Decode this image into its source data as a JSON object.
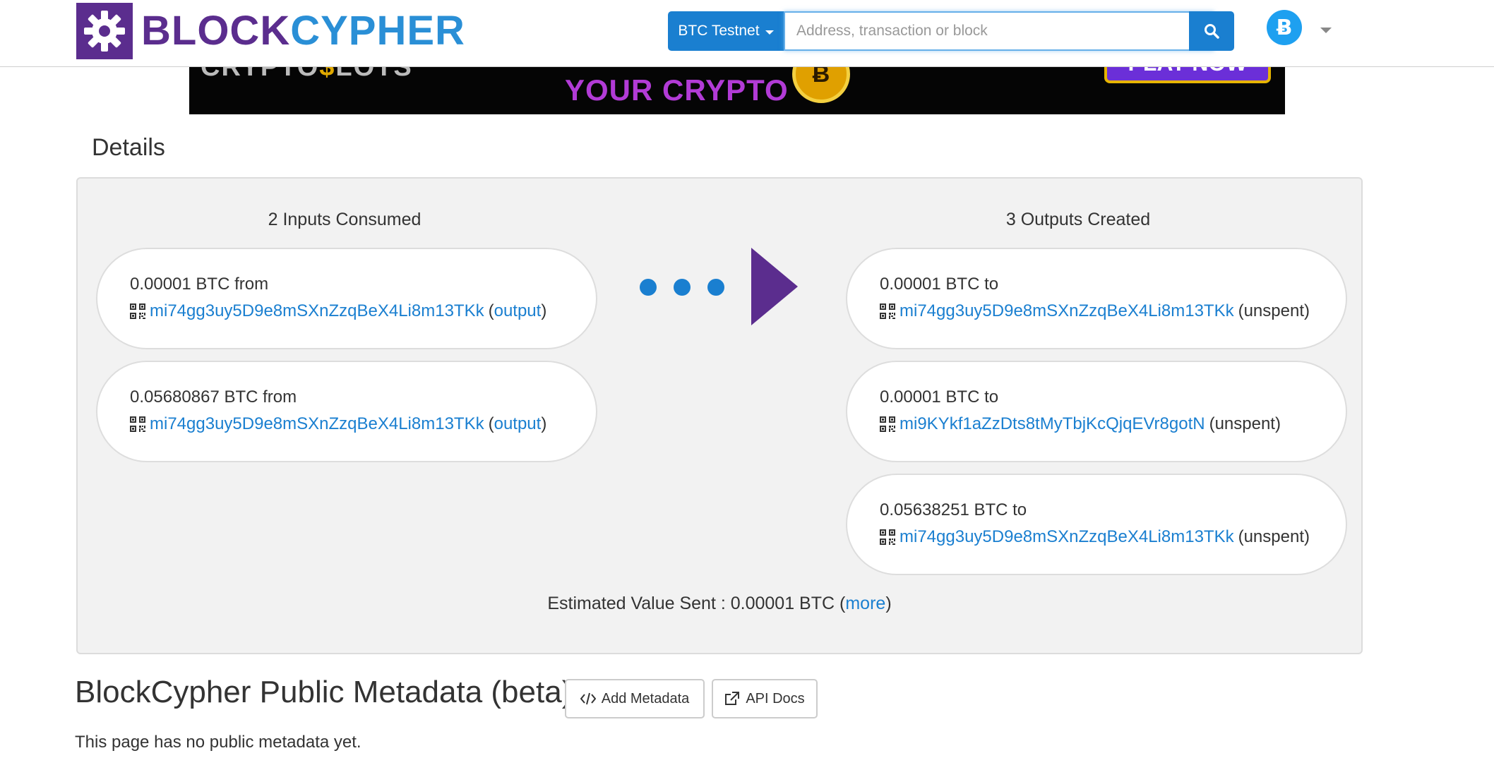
{
  "header": {
    "brand_part1": "BLOCK",
    "brand_part2": "CYPHER",
    "network_label": "BTC Testnet",
    "search_placeholder": "Address, transaction or block",
    "coin_symbol": "Ƀ",
    "colors": {
      "brand_purple": "#5b2d8e",
      "brand_blue": "#2a8fd6",
      "button_blue": "#1a7fd0",
      "coin_blue": "#1ea0f0"
    }
  },
  "banner": {
    "brand_fragment_a": "CRYPTO",
    "brand_fragment_b": "$",
    "brand_fragment_c": "LOTS",
    "headline": "YOUR CRYPTO",
    "coin_symbol": "Ƀ",
    "cta": "PLAY NOW"
  },
  "details": {
    "title": "Details",
    "inputs_heading": "2 Inputs Consumed",
    "outputs_heading": "3 Outputs Created",
    "inputs": [
      {
        "amount": "0.00001 BTC from",
        "address": "mi74gg3uy5D9e8mSXnZzqBeX4Li8m13TKk",
        "link_label": "output"
      },
      {
        "amount": "0.05680867 BTC from",
        "address": "mi74gg3uy5D9e8mSXnZzqBeX4Li8m13TKk",
        "link_label": "output"
      }
    ],
    "outputs": [
      {
        "amount": "0.00001 BTC to",
        "address": "mi74gg3uy5D9e8mSXnZzqBeX4Li8m13TKk",
        "status": "(unspent)"
      },
      {
        "amount": "0.00001 BTC to",
        "address": "mi9KYkf1aZzDts8tMyTbjKcQjqEVr8gotN",
        "status": "(unspent)"
      },
      {
        "amount": "0.05638251 BTC to",
        "address": "mi74gg3uy5D9e8mSXnZzqBeX4Li8m13TKk",
        "status": "(unspent)"
      }
    ],
    "estimate_text": "Estimated Value Sent : 0.00001 BTC",
    "more_label": "more"
  },
  "metadata": {
    "title": "BlockCypher Public Metadata (beta)",
    "add_button": "Add Metadata",
    "docs_button": "API Docs",
    "note": "This page has no public metadata yet."
  }
}
